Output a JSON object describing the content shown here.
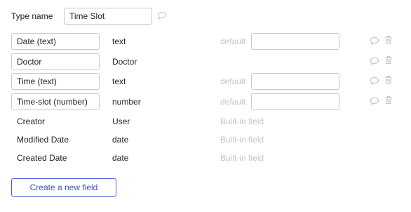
{
  "type_name": {
    "label": "Type name",
    "value": "Time Slot"
  },
  "fields": [
    {
      "name": "Date (text)",
      "type": "text",
      "default_label": "default",
      "default_value": ""
    },
    {
      "name": "Doctor",
      "type": "Doctor"
    },
    {
      "name": "Time (text)",
      "type": "text",
      "default_label": "default",
      "default_value": ""
    },
    {
      "name": "Time-slot (number)",
      "type": "number",
      "default_label": "default",
      "default_value": ""
    }
  ],
  "builtin_fields": [
    {
      "name": "Creator",
      "type": "User",
      "note": "Built-in field"
    },
    {
      "name": "Modified Date",
      "type": "date",
      "note": "Built-in field"
    },
    {
      "name": "Created Date",
      "type": "date",
      "note": "Built-in field"
    }
  ],
  "create_button_label": "Create a new field",
  "icons": {
    "comment": "comment-icon",
    "delete": "trash-icon"
  },
  "colors": {
    "accent": "#3c4dd6",
    "muted": "#c4c4c4",
    "border": "#c9c9c9",
    "icon": "#b9bec4"
  }
}
